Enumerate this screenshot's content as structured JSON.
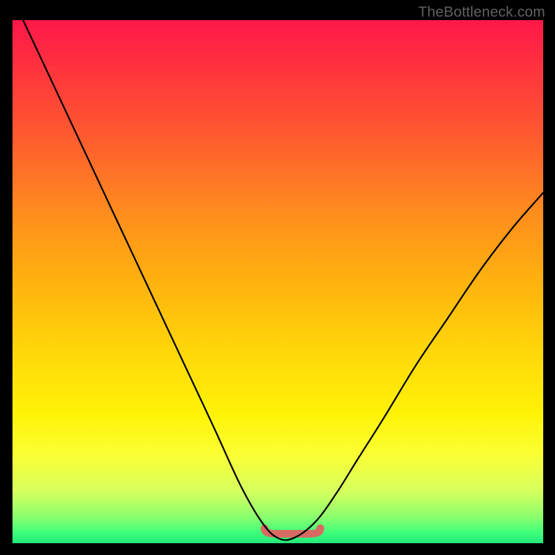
{
  "watermark": "TheBottleneck.com",
  "chart_data": {
    "type": "line",
    "title": "",
    "xlabel": "",
    "ylabel": "",
    "xlim": [
      0,
      1
    ],
    "ylim": [
      0,
      1
    ],
    "background_gradient": {
      "top": "#ff1748",
      "middle": "#ffd60a",
      "bottom": "#23e87a"
    },
    "series": [
      {
        "name": "bottleneck-curve",
        "color": "#000000",
        "x": [
          0.02,
          0.08,
          0.14,
          0.2,
          0.26,
          0.32,
          0.38,
          0.43,
          0.47,
          0.5,
          0.53,
          0.57,
          0.61,
          0.65,
          0.7,
          0.76,
          0.82,
          0.88,
          0.94,
          1.0
        ],
        "values": [
          1.0,
          0.87,
          0.74,
          0.61,
          0.48,
          0.35,
          0.22,
          0.11,
          0.04,
          0.01,
          0.01,
          0.04,
          0.095,
          0.16,
          0.24,
          0.34,
          0.43,
          0.52,
          0.6,
          0.67
        ]
      }
    ],
    "annotations": [
      {
        "name": "flat-bottom-marker",
        "color": "#d86a63",
        "x_range": [
          0.475,
          0.58
        ],
        "y": 0.018
      }
    ]
  }
}
